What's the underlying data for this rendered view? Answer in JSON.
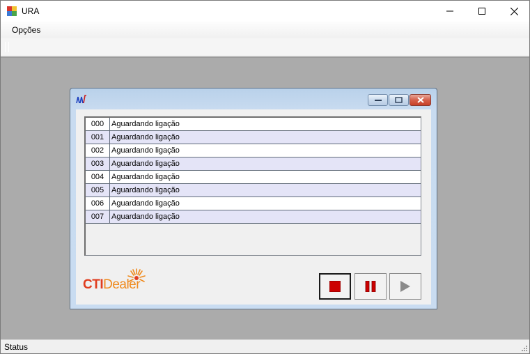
{
  "window": {
    "title": "URA",
    "icon": "app-icon"
  },
  "menu": {
    "items": [
      {
        "label": "Opções"
      }
    ]
  },
  "status": {
    "text": "Status"
  },
  "child": {
    "icon": "waveform-icon",
    "lines": [
      {
        "channel": "000",
        "state": "Aguardando ligação"
      },
      {
        "channel": "001",
        "state": "Aguardando ligação"
      },
      {
        "channel": "002",
        "state": "Aguardando ligação"
      },
      {
        "channel": "003",
        "state": "Aguardando ligação"
      },
      {
        "channel": "004",
        "state": "Aguardando ligação"
      },
      {
        "channel": "005",
        "state": "Aguardando ligação"
      },
      {
        "channel": "006",
        "state": "Aguardando ligação"
      },
      {
        "channel": "007",
        "state": "Aguardando ligação"
      }
    ],
    "logo": {
      "part1": "CTI",
      "part2": "Dealer"
    },
    "controls": [
      "stop-icon",
      "pause-icon",
      "play-icon"
    ]
  },
  "colors": {
    "row_alt": "#e4e4f7",
    "stop_red": "#cc0000",
    "pause_red": "#cc0000",
    "play_gray": "#8a8a8a",
    "logo_red": "#e03d1f",
    "logo_orange": "#ef8a1d"
  }
}
